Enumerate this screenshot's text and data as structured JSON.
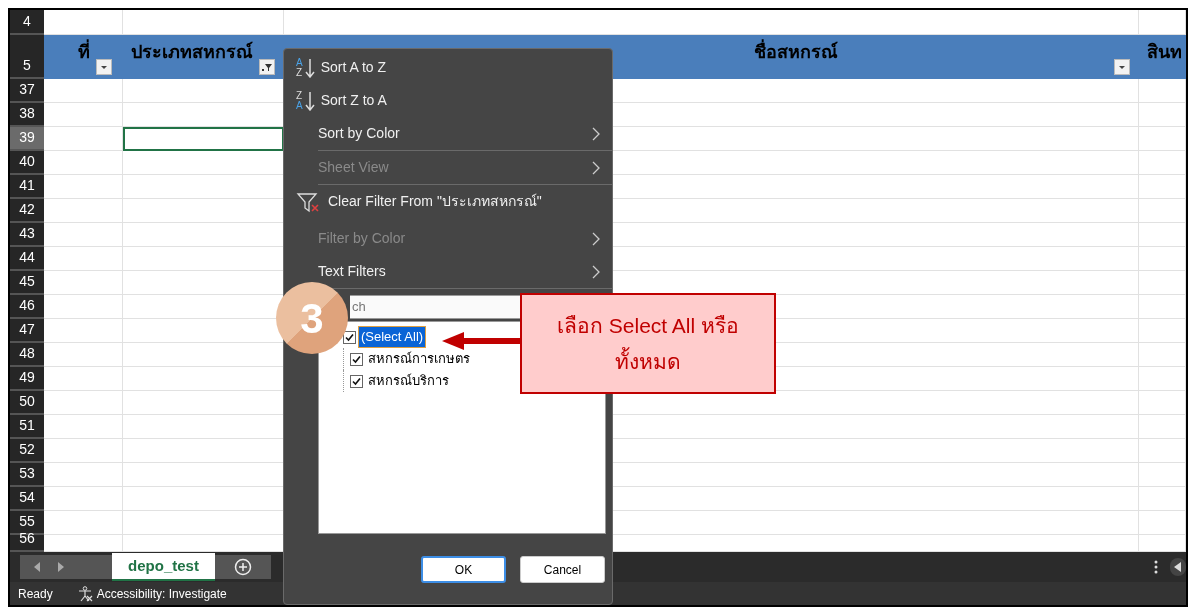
{
  "columns": [
    {
      "title": "ที่",
      "filter_button": true,
      "filtered": false
    },
    {
      "title": "ประเภทสหกรณ์",
      "filter_button": true,
      "filtered": true
    },
    {
      "title": "ชื่อสหกรณ์",
      "filter_button": true,
      "filtered": false
    },
    {
      "title": "สินท",
      "filter_button": false
    }
  ],
  "rows": [
    {
      "label": "4",
      "kind": "blank",
      "selected": false
    },
    {
      "label": "5",
      "kind": "header",
      "selected": false
    },
    {
      "label": "37",
      "kind": "data",
      "selected": false
    },
    {
      "label": "38",
      "kind": "data",
      "selected": false
    },
    {
      "label": "39",
      "kind": "data",
      "selected": true
    },
    {
      "label": "40",
      "kind": "data",
      "selected": false
    },
    {
      "label": "41",
      "kind": "data",
      "selected": false
    },
    {
      "label": "42",
      "kind": "data",
      "selected": false
    },
    {
      "label": "43",
      "kind": "data",
      "selected": false
    },
    {
      "label": "44",
      "kind": "data",
      "selected": false
    },
    {
      "label": "45",
      "kind": "data",
      "selected": false
    },
    {
      "label": "46",
      "kind": "data",
      "selected": false
    },
    {
      "label": "47",
      "kind": "data",
      "selected": false
    },
    {
      "label": "48",
      "kind": "data",
      "selected": false
    },
    {
      "label": "49",
      "kind": "data",
      "selected": false
    },
    {
      "label": "50",
      "kind": "data",
      "selected": false
    },
    {
      "label": "51",
      "kind": "data",
      "selected": false
    },
    {
      "label": "52",
      "kind": "data",
      "selected": false
    },
    {
      "label": "53",
      "kind": "data",
      "selected": false
    },
    {
      "label": "54",
      "kind": "data",
      "selected": false
    },
    {
      "label": "55",
      "kind": "data",
      "selected": false
    },
    {
      "label": "56",
      "kind": "data",
      "selected": false
    }
  ],
  "filter_menu": {
    "items": [
      {
        "kind": "sort_asc",
        "icon_letters": [
          "A",
          "Z"
        ],
        "label": "Sort A to Z",
        "disabled": false,
        "submenu": false,
        "separator_after": false
      },
      {
        "kind": "sort_desc",
        "icon_letters": [
          "Z",
          "A"
        ],
        "label": "Sort Z to A",
        "disabled": false,
        "submenu": false,
        "separator_after": false
      },
      {
        "kind": "plain",
        "label": "Sort by Color",
        "disabled": false,
        "submenu": true,
        "separator_after": true
      },
      {
        "kind": "plain",
        "label": "Sheet View",
        "disabled": true,
        "submenu": true,
        "separator_after": true
      },
      {
        "kind": "clear_filter",
        "label": "Clear Filter From \"ประเภทสหกรณ์\"",
        "disabled": false,
        "submenu": false,
        "separator_after": false
      },
      {
        "kind": "plain",
        "label": "Filter by Color",
        "disabled": true,
        "submenu": true,
        "separator_after": false
      },
      {
        "kind": "plain",
        "label": "Text Filters",
        "disabled": false,
        "submenu": true,
        "separator_after": true
      }
    ],
    "search": {
      "placeholder": "ch"
    },
    "checklist": [
      {
        "label": "(Select All)",
        "checked": true,
        "selected": true,
        "children": [
          {
            "label": "สหกรณ์การเกษตร",
            "checked": true,
            "selected": false
          },
          {
            "label": "สหกรณ์บริการ",
            "checked": true,
            "selected": false
          }
        ]
      }
    ],
    "buttons": [
      {
        "label": "OK",
        "default": true
      },
      {
        "label": "Cancel",
        "default": false
      }
    ]
  },
  "callout": {
    "badge": "3",
    "lines": [
      "เลือก Select All หรือ",
      "ทั้งหมด"
    ]
  },
  "sheet_tabs": [
    {
      "label": "depo_test",
      "selected": true
    }
  ],
  "status_bar": {
    "mode": "Ready",
    "accessibility": "Accessibility: Investigate"
  }
}
